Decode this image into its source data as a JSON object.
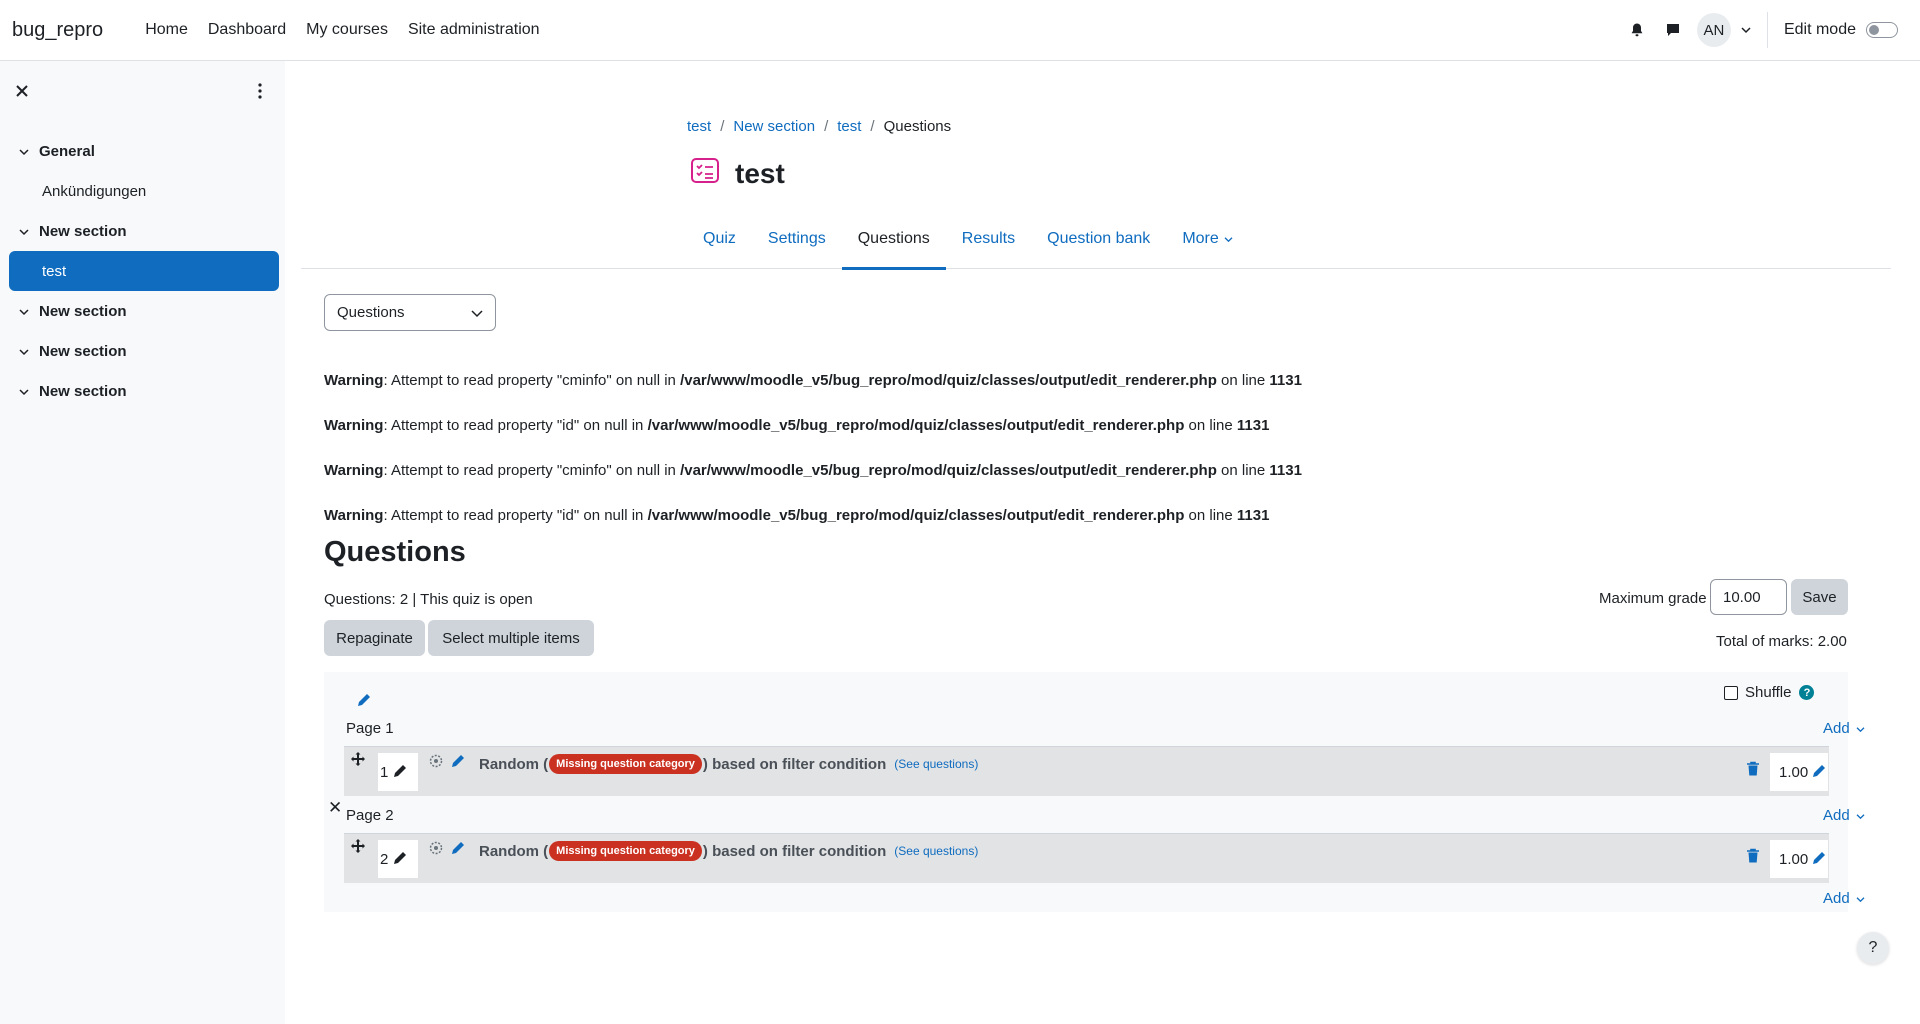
{
  "site": {
    "brand": "bug_repro"
  },
  "primary_nav": [
    "Home",
    "Dashboard",
    "My courses",
    "Site administration"
  ],
  "user": {
    "initials": "AN",
    "edit_mode_label": "Edit mode"
  },
  "course_index": [
    {
      "type": "section",
      "label": "General"
    },
    {
      "type": "item",
      "label": "Ankündigungen"
    },
    {
      "type": "section",
      "label": "New section"
    },
    {
      "type": "item",
      "label": "test",
      "active": true
    },
    {
      "type": "section",
      "label": "New section"
    },
    {
      "type": "section",
      "label": "New section"
    },
    {
      "type": "section",
      "label": "New section"
    }
  ],
  "breadcrumb": [
    "test",
    "New section",
    "test",
    "Questions"
  ],
  "page": {
    "title": "test"
  },
  "tabs": [
    {
      "label": "Quiz",
      "active": false
    },
    {
      "label": "Settings",
      "active": false
    },
    {
      "label": "Questions",
      "active": true
    },
    {
      "label": "Results",
      "active": false
    },
    {
      "label": "Question bank",
      "active": false
    },
    {
      "label": "More",
      "active": false
    }
  ],
  "select": {
    "value": "Questions"
  },
  "warnings": [
    {
      "label": "Warning",
      "msg1": ": Attempt to read property \"cminfo\" on null in ",
      "path": "/var/www/moodle_v5/bug_repro/mod/quiz/classes/output/edit_renderer.php",
      "msg2": " on line ",
      "line": "1131"
    },
    {
      "label": "Warning",
      "msg1": ": Attempt to read property \"id\" on null in ",
      "path": "/var/www/moodle_v5/bug_repro/mod/quiz/classes/output/edit_renderer.php",
      "msg2": " on line ",
      "line": "1131"
    },
    {
      "label": "Warning",
      "msg1": ": Attempt to read property \"cminfo\" on null in ",
      "path": "/var/www/moodle_v5/bug_repro/mod/quiz/classes/output/edit_renderer.php",
      "msg2": " on line ",
      "line": "1131"
    },
    {
      "label": "Warning",
      "msg1": ": Attempt to read property \"id\" on null in ",
      "path": "/var/www/moodle_v5/bug_repro/mod/quiz/classes/output/edit_renderer.php",
      "msg2": " on line ",
      "line": "1131"
    }
  ],
  "questions": {
    "heading": "Questions",
    "status": "Questions: 2 | This quiz is open",
    "repaginate": "Repaginate",
    "select_multiple": "Select multiple items",
    "max_grade_label": "Maximum grade",
    "max_grade_value": "10.00",
    "save": "Save",
    "total_marks": "Total of marks: 2.00",
    "shuffle": "Shuffle",
    "add": "Add",
    "pages": [
      {
        "label": "Page 1",
        "slot": {
          "number": "1",
          "text_before": "Random (",
          "badge": "Missing question category",
          "text_after": ") based on filter condition",
          "see": "(See questions)",
          "mark": "1.00"
        }
      },
      {
        "label": "Page 2",
        "slot": {
          "number": "2",
          "text_before": "Random (",
          "badge": "Missing question category",
          "text_after": ") based on filter condition",
          "see": "(See questions)",
          "mark": "1.00"
        }
      }
    ]
  },
  "colors": {
    "primary": "#0f6cbf",
    "danger": "#ca3120",
    "info": "#008196"
  }
}
